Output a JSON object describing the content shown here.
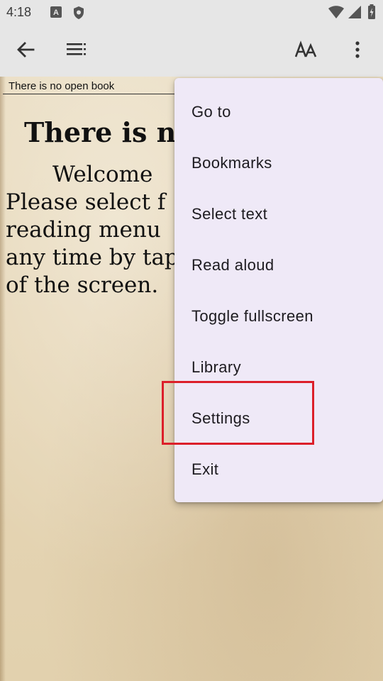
{
  "status_bar": {
    "time": "4:18"
  },
  "app_bar": {
    "back_icon": "arrow-left-icon",
    "toc_icon": "table-of-contents-icon",
    "font_icon": "font-size-icon",
    "more_icon": "more-vertical-icon"
  },
  "reader": {
    "status_line": "There is no open book",
    "title": "There is n",
    "lines": [
      "Welcome",
      "Please  select  f",
      "reading  menu",
      "any time by tap",
      "of the screen."
    ]
  },
  "menu": {
    "items": [
      "Go to",
      "Bookmarks",
      "Select text",
      "Read aloud",
      "Toggle fullscreen",
      "Library",
      "Settings",
      "Exit"
    ],
    "highlighted_item": "Settings"
  },
  "colors": {
    "highlight": "#dc1f2a",
    "menu_background": "#efe9f7",
    "paper": "#e6d6b6"
  }
}
